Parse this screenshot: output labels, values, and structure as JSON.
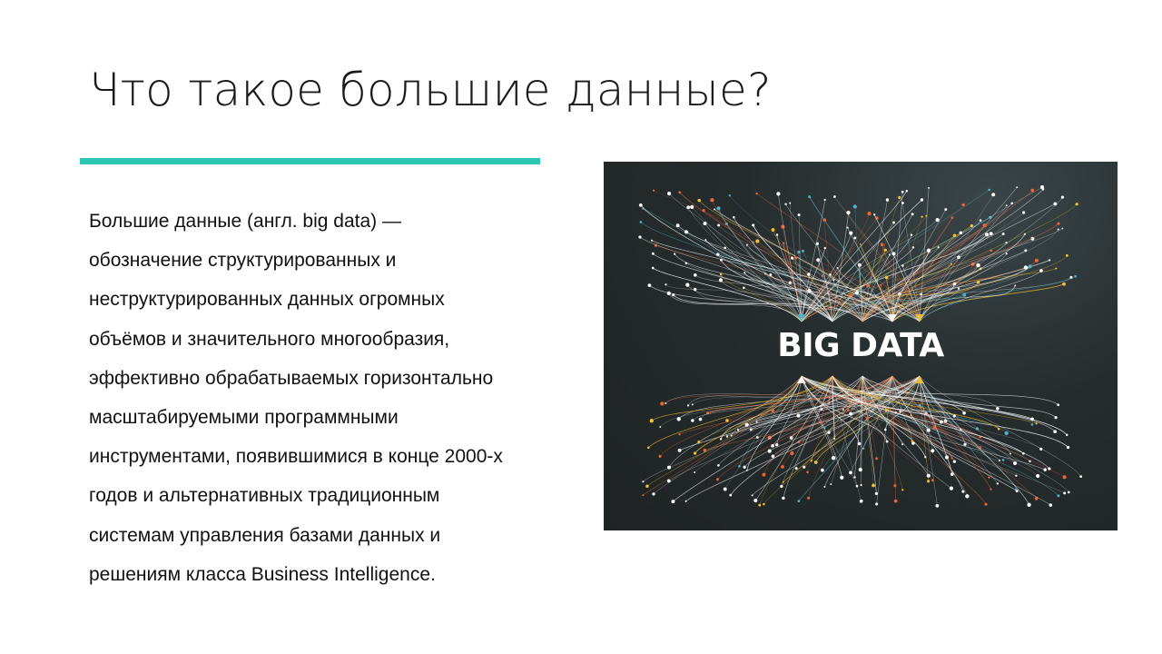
{
  "slide": {
    "title": "Что такое большие данные?",
    "accent_color": "#2ec5b3",
    "body_lines": [
      "Большие данные (англ. big data) —",
      "обозначение структурированных и",
      "неструктурированных данных огромных",
      "объёмов и значительного многообразия,",
      "эффективно обрабатываемых горизонтально",
      "масштабируемыми программными",
      "инструментами, появившимися в конце 2000-х",
      "годов и альтернативных традиционным",
      "системам управления базами данных и",
      "решениям класса Business Intelligence."
    ],
    "picture": {
      "label": "BIG DATA",
      "background_color": "#262c2d",
      "line_colors": [
        "#ffffff",
        "#e8643a",
        "#f2c230",
        "#4fb3c8"
      ]
    }
  }
}
